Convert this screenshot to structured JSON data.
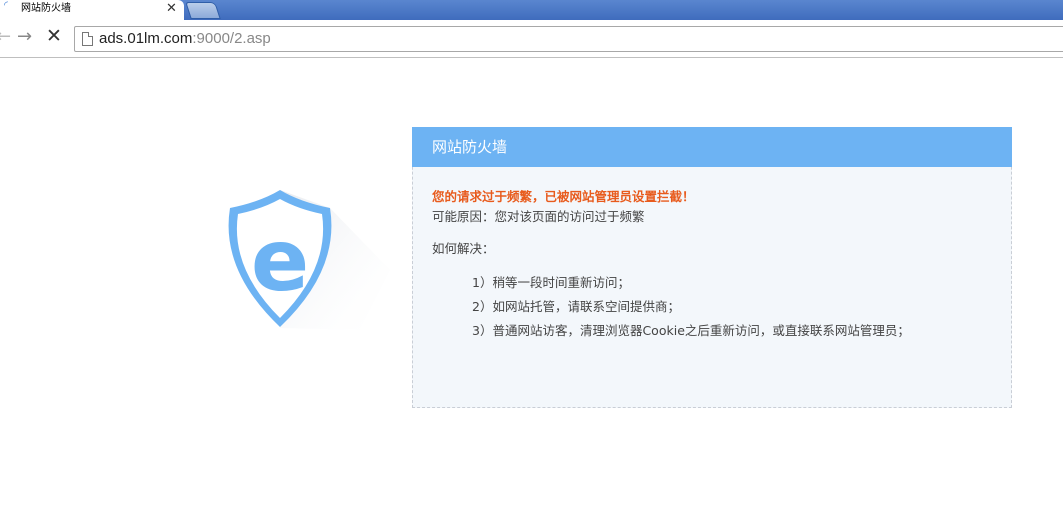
{
  "browser": {
    "tab": {
      "title": "网站防火墙",
      "close_glyph": "✕",
      "favicon": "loading-spinner-icon"
    },
    "nav": {
      "back_glyph": "←",
      "forward_glyph": "→",
      "stop_glyph": "✕"
    },
    "address": {
      "host": "ads.01lm.com",
      "path": ":9000/2.asp"
    }
  },
  "logo": {
    "icon": "shield-e-icon",
    "letter": "e",
    "color": "#6db3f3"
  },
  "panel": {
    "title": "网站防火墙",
    "alert": "您的请求过于频繁，已被网站管理员设置拦截！",
    "reason": "可能原因：您对该页面的访问过于频繁",
    "howto": "如何解决：",
    "steps": [
      "1）稍等一段时间重新访问；",
      "2）如网站托管，请联系空间提供商；",
      "3）普通网站访客，清理浏览器Cookie之后重新访问，或直接联系网站管理员；"
    ]
  },
  "colors": {
    "header_blue": "#6db3f3",
    "alert_orange": "#e85b1d",
    "panel_bg": "#f3f7fb"
  }
}
